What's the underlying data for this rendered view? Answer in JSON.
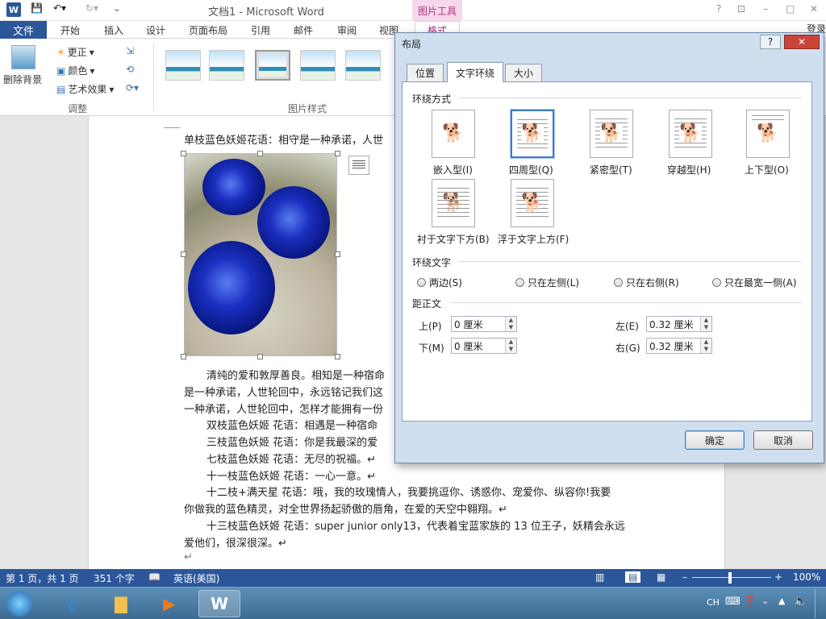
{
  "app": {
    "title": "文档1 - Microsoft Word",
    "picture_tools": "图片工具",
    "login": "登录",
    "window_controls": [
      "?",
      "⊡",
      "–",
      "□",
      "✕"
    ]
  },
  "ribbon": {
    "file_tab": "文件",
    "tabs": [
      "开始",
      "插入",
      "设计",
      "页面布局",
      "引用",
      "邮件",
      "审阅",
      "视图"
    ],
    "format_tab": "格式",
    "remove_bg": "删除背景",
    "corrections": "更正",
    "color": "颜色",
    "artistic": "艺术效果",
    "group_adjust": "调整",
    "group_styles": "图片样式"
  },
  "document": {
    "lines": [
      "单枝蓝色妖姬花语：相守是一种承诺，人世",
      "清纯的爱和敦厚善良。相知是一种宿命",
      "是一种承诺，人世轮回中，永远铭记我们这",
      "一种承诺，人世轮回中，怎样才能拥有一份",
      "双枝蓝色妖姬 花语：相遇是一种宿命",
      "三枝蓝色妖姬 花语：你是我最深的爱",
      "七枝蓝色妖姬 花语：无尽的祝福。↵",
      "十一枝蓝色妖姬 花语：一心一意。↵",
      "十二枝+满天星 花语：哦，我的玫瑰情人，我要挑逗你、诱惑你、宠爱你、纵容你!我要",
      "你做我的蓝色精灵，对全世界扬起骄傲的唇角，在爱的天空中翱翔。↵",
      "十三枝蓝色妖姬 花语：super junior only13，代表着宝蓝家族的 13 位王子，妖精会永远",
      "爱他们，很深很深。↵",
      "↵"
    ]
  },
  "status": {
    "page": "第 1 页，共 1 页",
    "words": "351 个字",
    "language": "英语(美国)",
    "zoom": "100%"
  },
  "taskbar": {
    "ime": "CH"
  },
  "dialog": {
    "title": "布局",
    "help": "?",
    "close": "✕",
    "tabs": [
      "位置",
      "文字环绕",
      "大小"
    ],
    "wrap_section": "环绕方式",
    "wrap_options": [
      "嵌入型(I)",
      "四周型(Q)",
      "紧密型(T)",
      "穿越型(H)",
      "上下型(O)",
      "衬于文字下方(B)",
      "浮于文字上方(F)"
    ],
    "wrap_text_section": "环绕文字",
    "wrap_text_options": [
      "两边(S)",
      "只在左侧(L)",
      "只在右侧(R)",
      "只在最宽一侧(A)"
    ],
    "distance_section": "距正文",
    "top_label": "上(P)",
    "top_value": "0 厘米",
    "bottom_label": "下(M)",
    "bottom_value": "0 厘米",
    "left_label": "左(E)",
    "left_value": "0.32 厘米",
    "right_label": "右(G)",
    "right_value": "0.32 厘米",
    "ok": "确定",
    "cancel": "取消"
  }
}
